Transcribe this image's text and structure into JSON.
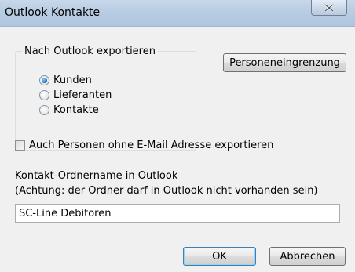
{
  "window": {
    "title": "Outlook Kontakte",
    "close_icon": "close-x-icon"
  },
  "export_group": {
    "legend": "Nach Outlook exportieren",
    "options": [
      {
        "label": "Kunden",
        "checked": true
      },
      {
        "label": "Lieferanten",
        "checked": false
      },
      {
        "label": "Kontakte",
        "checked": false
      }
    ]
  },
  "filter_button_label": "Personeneingrenzung",
  "no_email_checkbox": {
    "label": "Auch Personen ohne E-Mail Adresse exportieren",
    "checked": false
  },
  "folder": {
    "label_line1": "Kontakt-Ordnername in Outlook",
    "label_line2": "(Achtung: der Ordner darf in Outlook nicht vorhanden sein)",
    "value": "SC-Line Debitoren"
  },
  "buttons": {
    "ok": "OK",
    "cancel": "Abbrechen"
  },
  "colors": {
    "titlebar": "#b9cde3",
    "dialog_bg": "#f0f0f0",
    "radio_selected": "#1f77c7"
  }
}
